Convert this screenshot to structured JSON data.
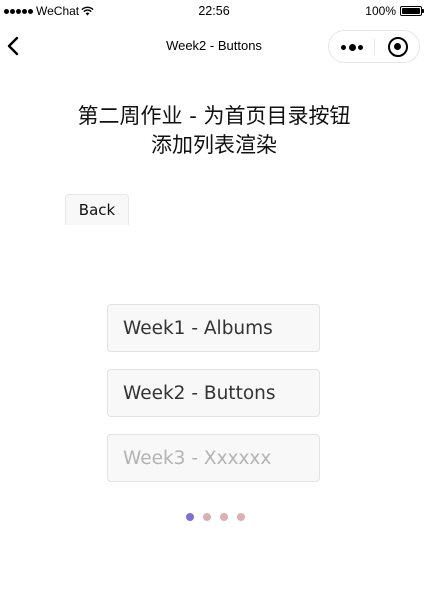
{
  "status_bar": {
    "carrier": "WeChat",
    "time": "22:56",
    "battery_text": "100%"
  },
  "nav": {
    "title": "Week2 - Buttons"
  },
  "page": {
    "title_line1": "第二周作业 - 为首页目录按钮",
    "title_line2": "添加列表渲染",
    "back_label": "Back"
  },
  "weeks": [
    {
      "label": "Week1 - Albums",
      "enabled": true
    },
    {
      "label": "Week2 - Buttons",
      "enabled": true
    },
    {
      "label": "Week3 - Xxxxxx",
      "enabled": false
    }
  ],
  "pager": {
    "active_index": 0,
    "count": 4,
    "active_color": "#7d6fd6",
    "inactive_color": "#d8b0b5"
  }
}
